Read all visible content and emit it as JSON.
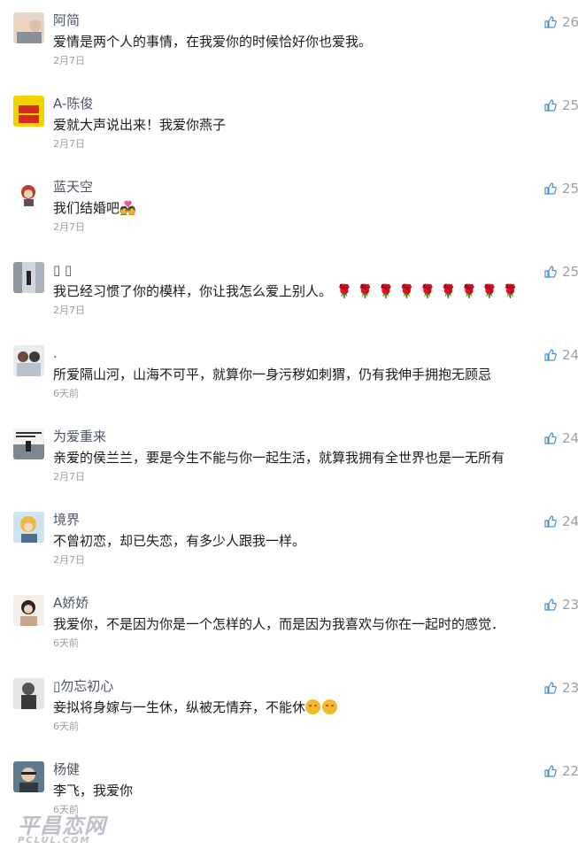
{
  "comments": [
    {
      "username": "阿简",
      "text": "爱情是两个人的事情，在我爱你的时候恰好你也爱我。",
      "time": "2月7日",
      "likes": "26"
    },
    {
      "username": "A-陈俊",
      "text": "爱就大声说出来！我爱你燕子",
      "time": "2月7日",
      "likes": "25"
    },
    {
      "username": "蓝天空",
      "text": "我们结婚吧💑",
      "time": "2月7日",
      "likes": "25"
    },
    {
      "username": "▯ ▯",
      "text": "我已经习惯了你的模样，你让我怎么爱上别人。",
      "roses": "🌹 🌹 🌹 🌹 🌹 🌹 🌹 🌹 🌹",
      "time": "2月7日",
      "likes": "25"
    },
    {
      "username": ".",
      "text": "所爱隔山河，山海不可平，就算你一身污秽如刺猬，仍有我伸手拥抱无顾忌",
      "time": "6天前",
      "likes": "24"
    },
    {
      "username": "为爱重来",
      "text": "亲爱的侯兰兰，要是今生不能与你一起生活，就算我拥有全世界也是一无所有",
      "time": "2月7日",
      "likes": "24"
    },
    {
      "username": "境界",
      "text": "不曾初恋，却已失恋，有多少人跟我一样。",
      "time": "2月7日",
      "likes": "24"
    },
    {
      "username": "A娇娇",
      "text": "我爱你，不是因为你是一个怎样的人，而是因为我喜欢与你在一起时的感觉．",
      "time": "6天前",
      "likes": "23"
    },
    {
      "username": "▯勿忘初心",
      "text": "妾拟将身嫁与一生休，纵被无情弃，不能休",
      "time": "6天前",
      "likes": "23"
    },
    {
      "username": "杨健",
      "text": "李飞，我爱你",
      "time": "6天前",
      "likes": "22"
    }
  ],
  "watermark": {
    "main": "平昌恋网",
    "sub": "PCLUL.COM"
  },
  "colors": {
    "username": "#4d5562",
    "text": "#1a1a1a",
    "meta": "#9aa0a8",
    "rose": "#d33333"
  },
  "icons": {
    "like": "thumbs-up-icon"
  }
}
